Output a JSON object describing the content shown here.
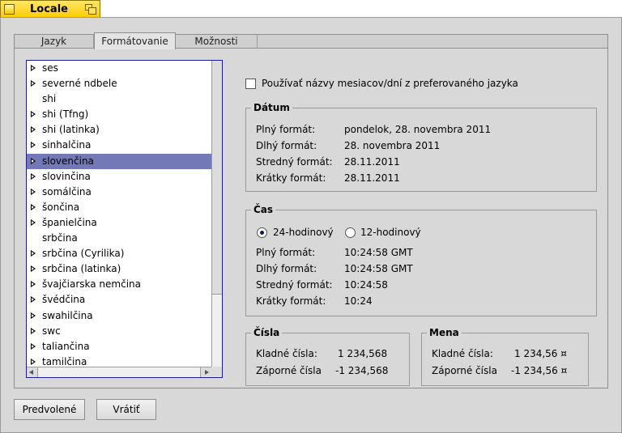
{
  "window": {
    "title": "Locale"
  },
  "tabs": [
    "Jazyk",
    "Formátovanie",
    "Možnosti"
  ],
  "active_tab": 1,
  "languages": [
    {
      "label": "ses",
      "expandable": true
    },
    {
      "label": "severné ndbele",
      "expandable": true
    },
    {
      "label": "shi",
      "expandable": false
    },
    {
      "label": "shi (Tfng)",
      "expandable": true
    },
    {
      "label": "shi (latinka)",
      "expandable": true
    },
    {
      "label": "sinhalčina",
      "expandable": true
    },
    {
      "label": "slovenčina",
      "expandable": true,
      "selected": true
    },
    {
      "label": "slovinčina",
      "expandable": true
    },
    {
      "label": "somálčina",
      "expandable": true
    },
    {
      "label": "šončina",
      "expandable": true
    },
    {
      "label": "španielčina",
      "expandable": true
    },
    {
      "label": "srbčina",
      "expandable": false
    },
    {
      "label": "srbčina (Cyrilika)",
      "expandable": true
    },
    {
      "label": "srbčina (latinka)",
      "expandable": true
    },
    {
      "label": "švajčiarska nemčina",
      "expandable": true
    },
    {
      "label": "švédčina",
      "expandable": true
    },
    {
      "label": "swahilčina",
      "expandable": true
    },
    {
      "label": "swc",
      "expandable": true
    },
    {
      "label": "taliančina",
      "expandable": true
    },
    {
      "label": "tamilčina",
      "expandable": true
    }
  ],
  "preferred_names_label": "Používať názvy mesiacov/dní z preferovaného jazyka",
  "date": {
    "title": "Dátum",
    "rows": [
      {
        "label": "Plný formát:",
        "value": "pondelok, 28. novembra 2011"
      },
      {
        "label": "Dlhý formát:",
        "value": "28. novembra 2011"
      },
      {
        "label": "Stredný formát:",
        "value": "28.11.2011"
      },
      {
        "label": "Krátky formát:",
        "value": "28.11.2011"
      }
    ]
  },
  "time": {
    "title": "Čas",
    "radio_24": "24-hodinový",
    "radio_12": "12-hodinový",
    "rows": [
      {
        "label": "Plný formát:",
        "value": "10:24:58 GMT"
      },
      {
        "label": "Dlhý formát:",
        "value": "10:24:58 GMT"
      },
      {
        "label": "Stredný formát:",
        "value": "10:24:58"
      },
      {
        "label": "Krátky formát:",
        "value": "10:24"
      }
    ]
  },
  "numbers": {
    "title": "Čísla",
    "positive_label": "Kladné čísla:",
    "positive_value": "1 234,568",
    "negative_label": "Záporné čísla",
    "negative_value": "-1 234,568"
  },
  "currency": {
    "title": "Mena",
    "positive_label": "Kladné čísla:",
    "positive_value": "1 234,56 ¤",
    "negative_label": "Záporné čísla",
    "negative_value": "-1 234,56 ¤"
  },
  "buttons": {
    "defaults": "Predvolené",
    "revert": "Vrátiť"
  }
}
